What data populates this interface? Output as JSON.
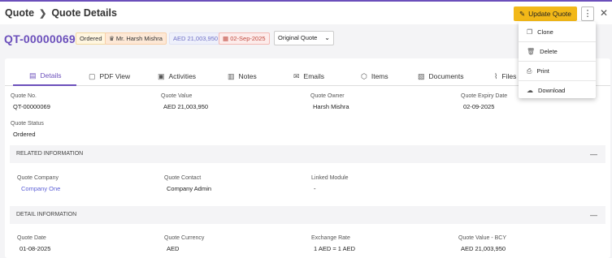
{
  "header": {
    "breadcrumb": [
      "Quote",
      "Quote Details"
    ],
    "update_button": "Update Quote",
    "more_label": "⋮",
    "close_label": "✕"
  },
  "summary": {
    "quote_number": "QT-00000069",
    "status": "Ordered",
    "owner": "Mr. Harsh Mishra",
    "amount": "AED 21,003,950",
    "expiry": "02-Sep-2025",
    "version_select": "Original Quote"
  },
  "tabs": [
    "Details",
    "PDF View",
    "Activities",
    "Notes",
    "Emails",
    "Items",
    "Documents",
    "Files"
  ],
  "details": {
    "fields": [
      {
        "label": "Quote No.",
        "value": "QT-00000069"
      },
      {
        "label": "Quote Value",
        "value": "AED 21,003,950"
      },
      {
        "label": "Quote Owner",
        "value": "Harsh Mishra"
      },
      {
        "label": "Quote Expiry Date",
        "value": "02-09-2025"
      },
      {
        "label": "Quote Status",
        "value": "Ordered"
      }
    ]
  },
  "related": {
    "title": "RELATED INFORMATION",
    "fields": [
      {
        "label": "Quote Company",
        "value": "Company One"
      },
      {
        "label": "Quote Contact",
        "value": "Company Admin"
      },
      {
        "label": "Linked Module",
        "value": "-"
      }
    ]
  },
  "detail_info": {
    "title": "DETAIL INFORMATION",
    "fields": [
      {
        "label": "Quote Date",
        "value": "01-08-2025"
      },
      {
        "label": "Quote Currency",
        "value": "AED"
      },
      {
        "label": "Exchange Rate",
        "value": "1 AED = 1 AED"
      },
      {
        "label": "Quote Value - BCY",
        "value": "AED 21,003,950"
      }
    ]
  },
  "menu": [
    "Clone",
    "Delete",
    "Print",
    "Download"
  ],
  "colors": {
    "accent": "#6b4fbb",
    "update_button": "#f2b818",
    "link": "#5b5fd6"
  }
}
